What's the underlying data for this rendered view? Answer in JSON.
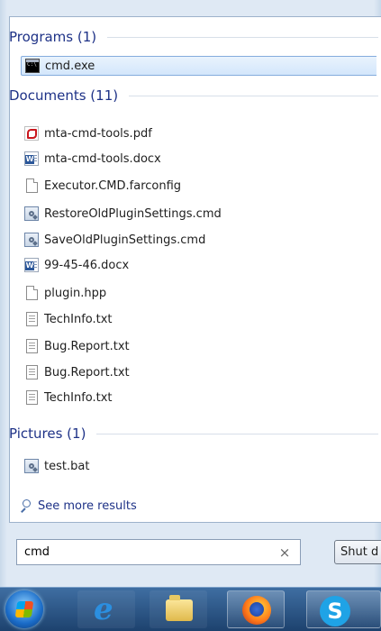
{
  "groups": [
    {
      "header": "Programs (1)",
      "items": [
        {
          "label": "cmd.exe",
          "icon": "cmd-icon"
        }
      ]
    },
    {
      "header": "Documents (11)",
      "items": [
        {
          "label": "mta-cmd-tools.pdf",
          "icon": "pdf-icon"
        },
        {
          "label": "mta-cmd-tools.docx",
          "icon": "word-doc-icon"
        },
        {
          "label": "Executor.CMD.farconfig",
          "icon": "blank-file-icon"
        },
        {
          "label": "RestoreOldPluginSettings.cmd",
          "icon": "batch-file-icon"
        },
        {
          "label": "SaveOldPluginSettings.cmd",
          "icon": "batch-file-icon"
        },
        {
          "label": "99-45-46.docx",
          "icon": "word-doc-icon"
        },
        {
          "label": "plugin.hpp",
          "icon": "blank-file-icon"
        },
        {
          "label": "TechInfo.txt",
          "icon": "text-file-icon"
        },
        {
          "label": "Bug.Report.txt",
          "icon": "text-file-icon"
        },
        {
          "label": "Bug.Report.txt",
          "icon": "text-file-icon"
        },
        {
          "label": "TechInfo.txt",
          "icon": "text-file-icon"
        }
      ]
    },
    {
      "header": "Pictures (1)",
      "items": [
        {
          "label": "test.bat",
          "icon": "batch-file-icon"
        }
      ]
    }
  ],
  "see_more": "See more results",
  "search": {
    "value": "cmd",
    "clear": "×"
  },
  "shutdown_label": "Shut d",
  "taskbar": {
    "items": [
      "start-orb",
      "internet-explorer-icon",
      "file-explorer-icon",
      "firefox-icon",
      "skype-icon"
    ],
    "skype_glyph": "S",
    "ie_glyph": "e"
  }
}
